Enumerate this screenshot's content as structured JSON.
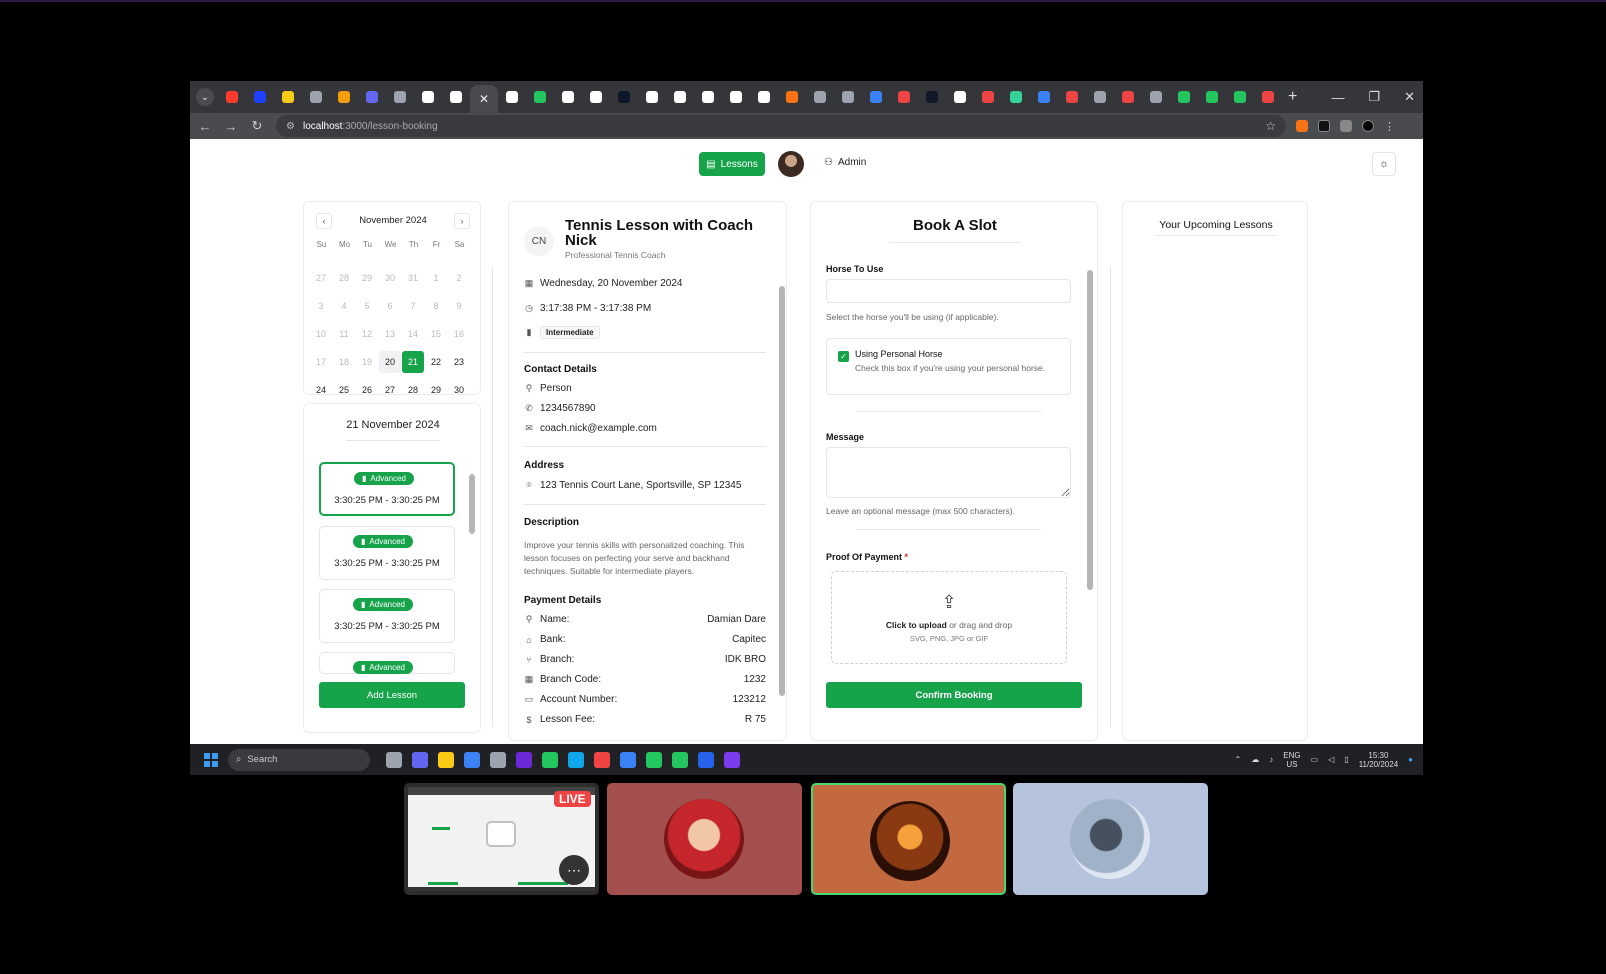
{
  "browser": {
    "url_host": "localhost",
    "url_path": ":3000/lesson-booking",
    "tab_colors": [
      "#ff3b30",
      "#1e40ff",
      "#facc15",
      "#9ca3af",
      "#f59e0b",
      "#6366f1",
      "#9ca3af",
      "#ffffff",
      "#ffffff",
      "#ffffff",
      "#ffffff",
      "#22c55e",
      "#ffffff",
      "#ffffff",
      "#0f172a",
      "#ffffff",
      "#ffffff",
      "#ffffff",
      "#ffffff",
      "#ffffff",
      "#f97316",
      "#9ca3af",
      "#9ca3af",
      "#3b82f6",
      "#ef4444",
      "#111827",
      "#ffffff",
      "#ef4444",
      "#34d399",
      "#3b82f6",
      "#ef4444",
      "#9ca3af",
      "#ef4444",
      "#9ca3af",
      "#22c55e",
      "#22c55e",
      "#22c55e",
      "#ef4444"
    ]
  },
  "header": {
    "lessons_label": "Lessons",
    "admin_label": "Admin",
    "theme_icon": "sun-icon"
  },
  "calendar": {
    "month_label": "November 2024",
    "dow": [
      "Su",
      "Mo",
      "Tu",
      "We",
      "Th",
      "Fr",
      "Sa"
    ],
    "days": [
      {
        "d": "27",
        "m": true
      },
      {
        "d": "28",
        "m": true
      },
      {
        "d": "29",
        "m": true
      },
      {
        "d": "30",
        "m": true
      },
      {
        "d": "31",
        "m": true
      },
      {
        "d": "1",
        "m": true
      },
      {
        "d": "2",
        "m": true
      },
      {
        "d": "3",
        "m": true
      },
      {
        "d": "4",
        "m": true
      },
      {
        "d": "5",
        "m": true
      },
      {
        "d": "6",
        "m": true
      },
      {
        "d": "7",
        "m": true
      },
      {
        "d": "8",
        "m": true
      },
      {
        "d": "9",
        "m": true
      },
      {
        "d": "10",
        "m": true
      },
      {
        "d": "11",
        "m": true
      },
      {
        "d": "12",
        "m": true
      },
      {
        "d": "13",
        "m": true
      },
      {
        "d": "14",
        "m": true
      },
      {
        "d": "15",
        "m": true
      },
      {
        "d": "16",
        "m": true
      },
      {
        "d": "17",
        "m": true
      },
      {
        "d": "18",
        "m": true
      },
      {
        "d": "19",
        "m": true
      },
      {
        "d": "20",
        "t": true
      },
      {
        "d": "21",
        "s": true
      },
      {
        "d": "22"
      },
      {
        "d": "23"
      },
      {
        "d": "24"
      },
      {
        "d": "25"
      },
      {
        "d": "26"
      },
      {
        "d": "27"
      },
      {
        "d": "28"
      },
      {
        "d": "29"
      },
      {
        "d": "30"
      }
    ]
  },
  "slots": {
    "date_title": "21 November 2024",
    "items": [
      {
        "level": "Advanced",
        "time": "3:30:25 PM - 3:30:25 PM"
      },
      {
        "level": "Advanced",
        "time": "3:30:25 PM - 3:30:25 PM"
      },
      {
        "level": "Advanced",
        "time": "3:30:25 PM - 3:30:25 PM"
      },
      {
        "level": "Advanced",
        "time": ""
      }
    ],
    "add_label": "Add Lesson"
  },
  "details": {
    "initials": "CN",
    "title": "Tennis Lesson with Coach Nick",
    "subtitle": "Professional Tennis Coach",
    "date": "Wednesday, 20 November 2024",
    "time": "3:17:38 PM - 3:17:38 PM",
    "level": "Intermediate",
    "contact_heading": "Contact Details",
    "contact_name": "Person",
    "contact_phone": "1234567890",
    "contact_email": "coach.nick@example.com",
    "address_heading": "Address",
    "address": "123 Tennis Court Lane, Sportsville, SP 12345",
    "description_heading": "Description",
    "description": "Improve your tennis skills with personalized coaching. This lesson focuses on perfecting your serve and backhand techniques. Suitable for intermediate players.",
    "payment_heading": "Payment Details",
    "payment": [
      {
        "label": "Name:",
        "value": "Damian Dare",
        "icon": "user-icon"
      },
      {
        "label": "Bank:",
        "value": "Capitec",
        "icon": "bank-icon"
      },
      {
        "label": "Branch:",
        "value": "IDK BRO",
        "icon": "branch-icon"
      },
      {
        "label": "Branch Code:",
        "value": "1232",
        "icon": "qr-icon"
      },
      {
        "label": "Account Number:",
        "value": "123212",
        "icon": "card-icon"
      },
      {
        "label": "Lesson Fee:",
        "value": "R 75",
        "icon": "dollar-icon"
      }
    ]
  },
  "booking": {
    "title": "Book A Slot",
    "horse_label": "Horse To Use",
    "horse_value": "",
    "horse_hint": "Select the horse you'll be using (if applicable).",
    "personal_label": "Using Personal Horse",
    "personal_hint": "Check this box if you're using your personal horse.",
    "message_label": "Message",
    "message_value": "",
    "message_hint": "Leave an optional message (max 500 characters).",
    "proof_label": "Proof Of Payment",
    "proof_req": "*",
    "upload_click": "Click to upload",
    "upload_rest": " or drag and drop",
    "upload_formats": "SVG, PNG, JPG or GIF",
    "confirm_label": "Confirm Booking"
  },
  "upcoming": {
    "title": "Your Upcoming Lessons"
  },
  "taskbar": {
    "search_label": "Search",
    "app_colors": [
      "#9ca3af",
      "#6366f1",
      "#facc15",
      "#3b82f6",
      "#9ca3af",
      "#6d28d9",
      "#22c55e",
      "#0ea5e9",
      "#ef4444",
      "#3b82f6",
      "#22c55e",
      "#22c55e",
      "#2563eb",
      "#7c3aed"
    ],
    "lang_top": "ENG",
    "lang_bottom": "US",
    "time": "15:30",
    "date": "11/20/2024"
  },
  "meeting": {
    "live_label": "LIVE"
  }
}
